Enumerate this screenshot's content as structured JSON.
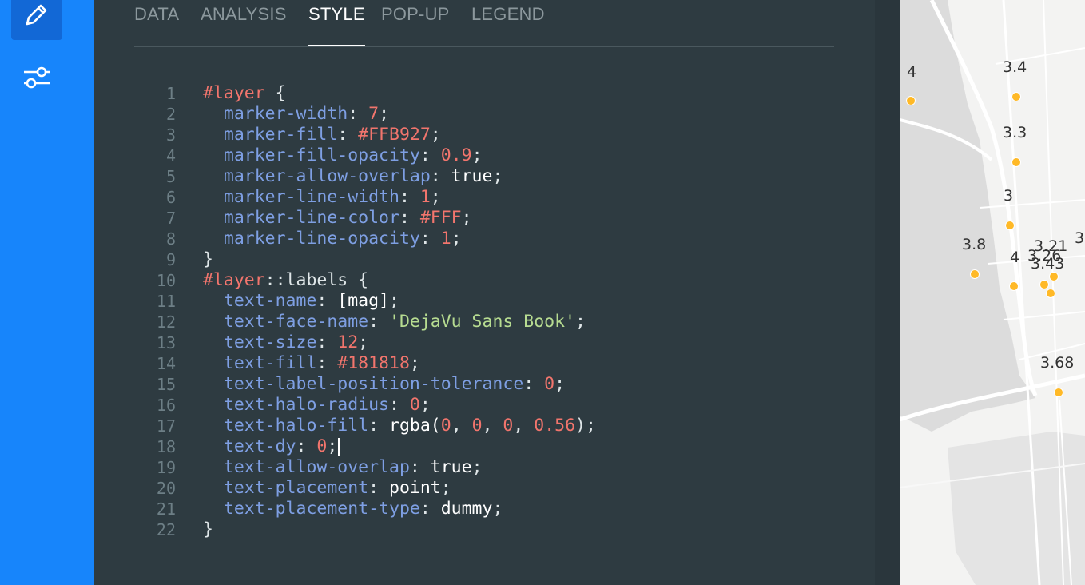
{
  "tabs": [
    "DATA",
    "ANALYSIS",
    "STYLE",
    "POP-UP",
    "LEGEND"
  ],
  "active_tab": "STYLE",
  "code_lines": [
    {
      "n": "1",
      "tokens": [
        [
          "sel",
          "#layer"
        ],
        [
          "punc",
          " {"
        ]
      ]
    },
    {
      "n": "2",
      "tokens": [
        [
          "prop",
          "  marker-width"
        ],
        [
          "punc",
          ": "
        ],
        [
          "num",
          "7"
        ],
        [
          "punc",
          ";"
        ]
      ]
    },
    {
      "n": "3",
      "tokens": [
        [
          "prop",
          "  marker-fill"
        ],
        [
          "punc",
          ": "
        ],
        [
          "num",
          "#FFB927"
        ],
        [
          "punc",
          ";"
        ]
      ]
    },
    {
      "n": "4",
      "tokens": [
        [
          "prop",
          "  marker-fill-opacity"
        ],
        [
          "punc",
          ": "
        ],
        [
          "num",
          "0.9"
        ],
        [
          "punc",
          ";"
        ]
      ]
    },
    {
      "n": "5",
      "tokens": [
        [
          "prop",
          "  marker-allow-overlap"
        ],
        [
          "punc",
          ": "
        ],
        [
          "kw",
          "true"
        ],
        [
          "punc",
          ";"
        ]
      ]
    },
    {
      "n": "6",
      "tokens": [
        [
          "prop",
          "  marker-line-width"
        ],
        [
          "punc",
          ": "
        ],
        [
          "num",
          "1"
        ],
        [
          "punc",
          ";"
        ]
      ]
    },
    {
      "n": "7",
      "tokens": [
        [
          "prop",
          "  marker-line-color"
        ],
        [
          "punc",
          ": "
        ],
        [
          "num",
          "#FFF"
        ],
        [
          "punc",
          ";"
        ]
      ]
    },
    {
      "n": "8",
      "tokens": [
        [
          "prop",
          "  marker-line-opacity"
        ],
        [
          "punc",
          ": "
        ],
        [
          "num",
          "1"
        ],
        [
          "punc",
          ";"
        ]
      ]
    },
    {
      "n": "9",
      "tokens": [
        [
          "punc",
          "}"
        ]
      ]
    },
    {
      "n": "10",
      "tokens": [
        [
          "sel",
          "#layer"
        ],
        [
          "punc",
          "::labels {"
        ]
      ]
    },
    {
      "n": "11",
      "tokens": [
        [
          "prop",
          "  text-name"
        ],
        [
          "punc",
          ": "
        ],
        [
          "kw",
          "[mag]"
        ],
        [
          "punc",
          ";"
        ]
      ]
    },
    {
      "n": "12",
      "tokens": [
        [
          "prop",
          "  text-face-name"
        ],
        [
          "punc",
          ": "
        ],
        [
          "str",
          "'DejaVu Sans Book'"
        ],
        [
          "punc",
          ";"
        ]
      ]
    },
    {
      "n": "13",
      "tokens": [
        [
          "prop",
          "  text-size"
        ],
        [
          "punc",
          ": "
        ],
        [
          "num",
          "12"
        ],
        [
          "punc",
          ";"
        ]
      ]
    },
    {
      "n": "14",
      "tokens": [
        [
          "prop",
          "  text-fill"
        ],
        [
          "punc",
          ": "
        ],
        [
          "num",
          "#181818"
        ],
        [
          "punc",
          ";"
        ]
      ]
    },
    {
      "n": "15",
      "tokens": [
        [
          "prop",
          "  text-label-position-tolerance"
        ],
        [
          "punc",
          ": "
        ],
        [
          "num",
          "0"
        ],
        [
          "punc",
          ";"
        ]
      ]
    },
    {
      "n": "16",
      "tokens": [
        [
          "prop",
          "  text-halo-radius"
        ],
        [
          "punc",
          ": "
        ],
        [
          "num",
          "0"
        ],
        [
          "punc",
          ";"
        ]
      ]
    },
    {
      "n": "17",
      "tokens": [
        [
          "prop",
          "  text-halo-fill"
        ],
        [
          "punc",
          ": "
        ],
        [
          "kw",
          "rgba("
        ],
        [
          "num",
          "0"
        ],
        [
          "punc",
          ", "
        ],
        [
          "num",
          "0"
        ],
        [
          "punc",
          ", "
        ],
        [
          "num",
          "0"
        ],
        [
          "punc",
          ", "
        ],
        [
          "num",
          "0.56"
        ],
        [
          "punc",
          ");"
        ]
      ]
    },
    {
      "n": "18",
      "tokens": [
        [
          "prop",
          "  text-dy"
        ],
        [
          "punc",
          ": "
        ],
        [
          "num",
          "0"
        ],
        [
          "punc",
          ";"
        ]
      ],
      "cursor": true
    },
    {
      "n": "19",
      "tokens": [
        [
          "prop",
          "  text-allow-overlap"
        ],
        [
          "punc",
          ": "
        ],
        [
          "kw",
          "true"
        ],
        [
          "punc",
          ";"
        ]
      ]
    },
    {
      "n": "20",
      "tokens": [
        [
          "prop",
          "  text-placement"
        ],
        [
          "punc",
          ": "
        ],
        [
          "kw",
          "point"
        ],
        [
          "punc",
          ";"
        ]
      ]
    },
    {
      "n": "21",
      "tokens": [
        [
          "prop",
          "  text-placement-type"
        ],
        [
          "punc",
          ": "
        ],
        [
          "kw",
          "dummy"
        ],
        [
          "punc",
          ";"
        ]
      ]
    },
    {
      "n": "22",
      "tokens": [
        [
          "punc",
          "}"
        ]
      ]
    }
  ],
  "map": {
    "labels": [
      "4",
      "3.4",
      "3.3",
      "3",
      "3.8",
      "4",
      "3.26",
      "3.21",
      "3.43",
      "3",
      "3.68"
    ],
    "marker_color": "#FFB927"
  },
  "colors": {
    "sidebar": "#1785fb",
    "editor_bg": "#2e3b41",
    "selector": "#f2756d",
    "property": "#7e9fe3",
    "string": "#b7dc91"
  }
}
